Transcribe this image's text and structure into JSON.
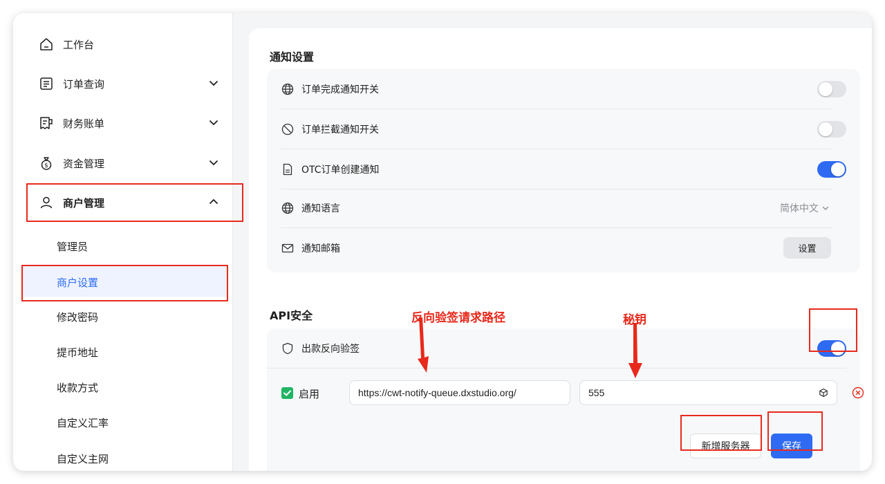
{
  "sidebar": {
    "items": [
      {
        "label": "工作台",
        "icon": "home-icon"
      },
      {
        "label": "订单查询",
        "icon": "document-list-icon"
      },
      {
        "label": "财务账单",
        "icon": "receipt-icon"
      },
      {
        "label": "资金管理",
        "icon": "money-bag-icon"
      },
      {
        "label": "商户管理",
        "icon": "user-icon"
      }
    ],
    "sub_items": [
      {
        "label": "管理员"
      },
      {
        "label": "商户设置"
      },
      {
        "label": "修改密码"
      },
      {
        "label": "提币地址"
      },
      {
        "label": "收款方式"
      },
      {
        "label": "自定义汇率"
      },
      {
        "label": "自定义主网"
      }
    ]
  },
  "notify": {
    "title": "通知设置",
    "rows": [
      {
        "label": "订单完成通知开关",
        "icon": "globe-icon",
        "enabled": false
      },
      {
        "label": "订单拦截通知开关",
        "icon": "ban-icon",
        "enabled": false
      },
      {
        "label": "OTC订单创建通知",
        "icon": "file-icon",
        "enabled": true
      },
      {
        "label": "通知语言",
        "icon": "globe-icon",
        "value": "简体中文"
      },
      {
        "label": "通知邮箱",
        "icon": "mail-icon",
        "button": "设置"
      }
    ]
  },
  "api": {
    "title": "API安全",
    "reverse_verify": {
      "label": "出款反向验签",
      "icon": "shield-icon",
      "enabled": true
    },
    "server": {
      "enabled_label": "启用",
      "url": "https://cwt-notify-queue.dxstudio.org/",
      "secret": "555"
    },
    "add_button": "新增服务器",
    "save_button": "保存"
  },
  "annotations": {
    "path_label": "反向验签请求路径",
    "secret_label": "秘钥"
  },
  "colors": {
    "accent": "#2f6bf2",
    "annotation": "#e8291c",
    "checkbox": "#21b464",
    "delete": "#e8291c"
  }
}
